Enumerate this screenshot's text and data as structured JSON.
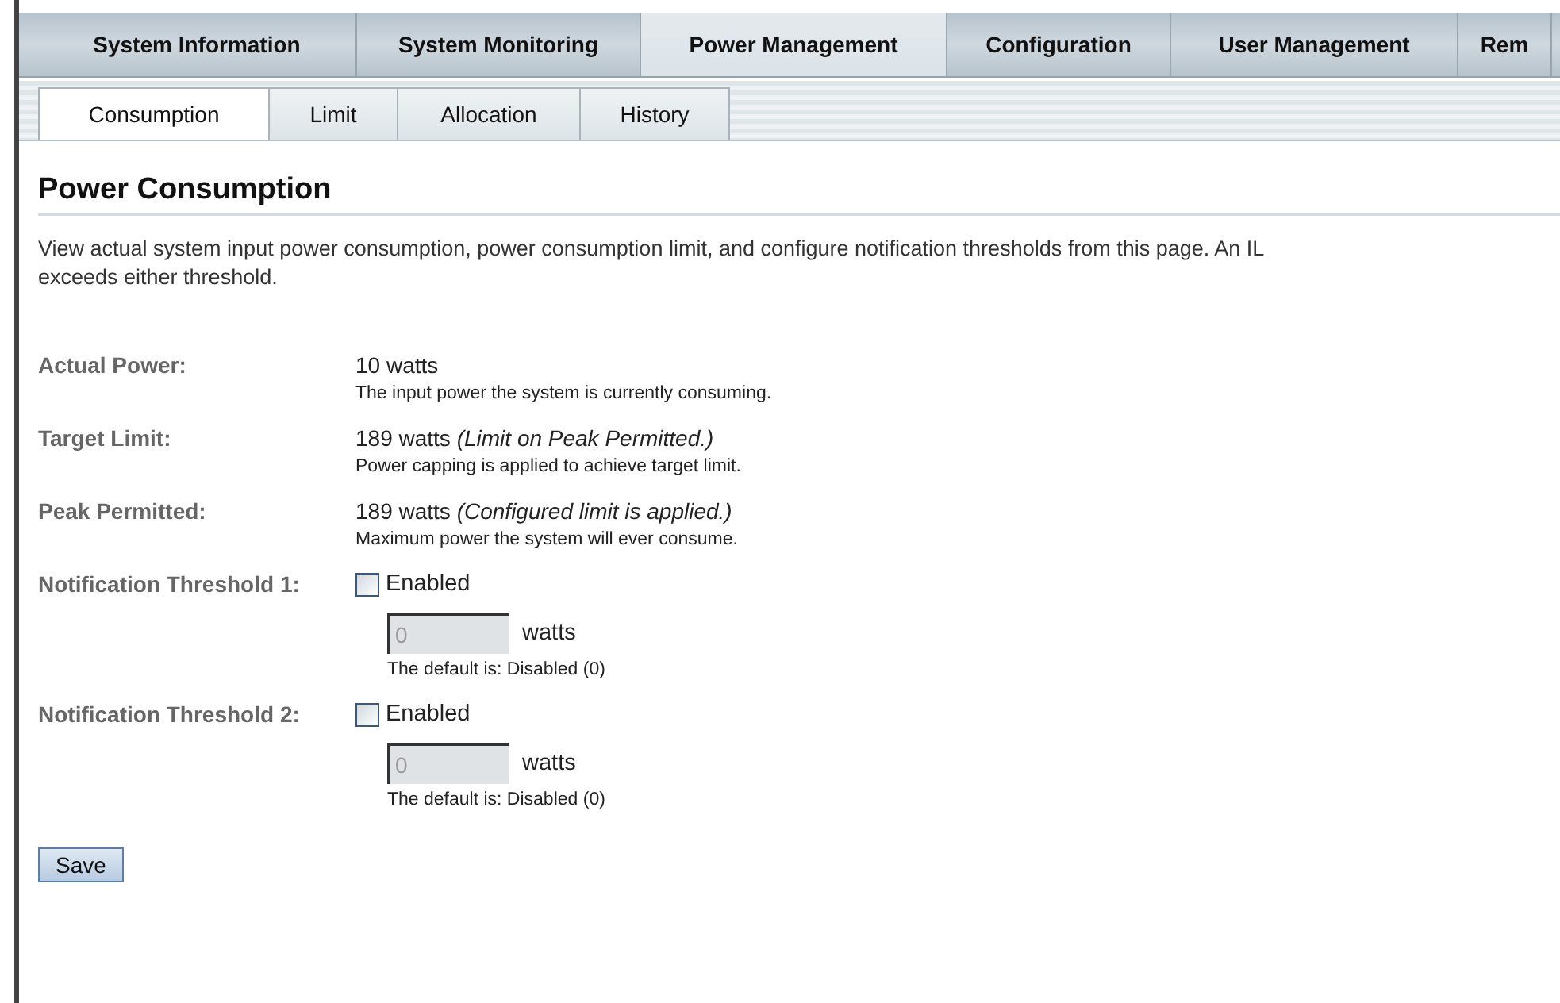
{
  "main_tabs": [
    {
      "label": "System Information",
      "selected": false
    },
    {
      "label": "System Monitoring",
      "selected": false
    },
    {
      "label": "Power Management",
      "selected": true
    },
    {
      "label": "Configuration",
      "selected": false
    },
    {
      "label": "User Management",
      "selected": false
    },
    {
      "label": "Rem",
      "selected": false
    }
  ],
  "sub_tabs": [
    {
      "label": "Consumption",
      "selected": true
    },
    {
      "label": "Limit",
      "selected": false
    },
    {
      "label": "Allocation",
      "selected": false
    },
    {
      "label": "History",
      "selected": false
    }
  ],
  "heading": "Power Consumption",
  "description_lines": [
    "View actual system input power consumption, power consumption limit, and configure notification thresholds from this page. An IL",
    "exceeds either threshold."
  ],
  "fields": [
    {
      "kind": "info",
      "label": "Actual Power:",
      "value": "10 watts",
      "hint": "The input power the system is currently consuming."
    },
    {
      "kind": "info",
      "label": "Target Limit:",
      "value": "189 watts *(Limit on Peak Permitted.)*",
      "hint": "Power capping is applied to achieve target limit."
    },
    {
      "kind": "info",
      "label": "Peak Permitted:",
      "value": "189 watts *(Configured limit is applied.)*",
      "hint": "Maximum power the system will ever consume."
    },
    {
      "kind": "threshold",
      "label": "Notification Threshold 1:",
      "checkbox_label": "Enabled",
      "checked": false,
      "input_value": "0",
      "unit": "watts",
      "hint": "The default is: Disabled (0)"
    },
    {
      "kind": "threshold",
      "label": "Notification Threshold 2:",
      "checkbox_label": "Enabled",
      "checked": false,
      "input_value": "0",
      "unit": "watts",
      "hint": "The default is: Disabled (0)"
    }
  ],
  "save_button": "Save"
}
